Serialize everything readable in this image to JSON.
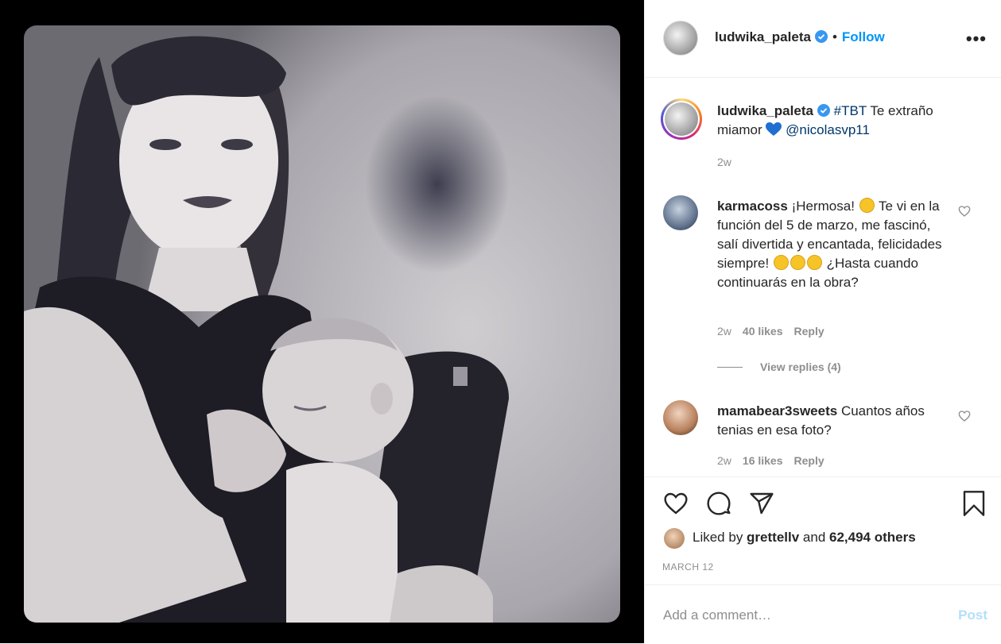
{
  "photo": {
    "alt_icon": "post-photo"
  },
  "header": {
    "username": "ludwika_paleta",
    "separator": "•",
    "follow_label": "Follow",
    "more_label": "•••"
  },
  "caption": {
    "username": "ludwika_paleta",
    "hashtag": "#TBT",
    "text": " Te extraño miamor ",
    "mention": "@nicolasvp11",
    "time": "2w"
  },
  "comments": [
    {
      "username": "karmacoss",
      "text_1": " ¡Hermosa! ",
      "text_2": " Te vi en la función del 5 de marzo, me fascinó, salí divertida y encantada, felicidades siempre! ",
      "text_3": " ¿Hasta cuando continuarás en la obra?",
      "time": "2w",
      "likes": "40 likes",
      "reply_label": "Reply",
      "view_replies": "View replies (4)"
    },
    {
      "username": "mamabear3sweets",
      "text": " Cuantos años tenias en esa foto?",
      "time": "2w",
      "likes": "16 likes",
      "reply_label": "Reply"
    }
  ],
  "likes": {
    "prefix": "Liked by ",
    "user": "grettellv",
    "middle": " and ",
    "count": "62,494 others"
  },
  "date": "MARCH 12",
  "add_comment": {
    "placeholder": "Add a comment…",
    "post_label": "Post"
  },
  "colors": {
    "link": "#0095f6",
    "tag": "#00376b",
    "muted": "#8e8e8e",
    "post_disabled": "#b2dffc"
  }
}
